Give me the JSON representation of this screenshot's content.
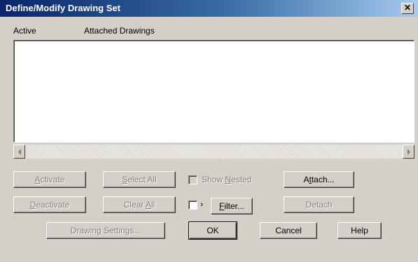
{
  "window": {
    "title": "Define/Modify Drawing Set",
    "close_glyph": "✕"
  },
  "list": {
    "columns": [
      {
        "label": "Active"
      },
      {
        "label": "Attached Drawings"
      }
    ],
    "rows": []
  },
  "buttons": {
    "activate": {
      "pre": "",
      "key": "A",
      "post": "ctivate"
    },
    "deactivate": {
      "pre": "",
      "key": "D",
      "post": "eactivate"
    },
    "select_all": {
      "pre": "",
      "key": "S",
      "post": "elect All"
    },
    "clear_all": {
      "pre": "Clear ",
      "key": "A",
      "post": "ll"
    },
    "attach": {
      "pre": "A",
      "key": "t",
      "post": "tach..."
    },
    "detach": {
      "pre": "Detach",
      "key": "",
      "post": ""
    },
    "filter": {
      "pre": "",
      "key": "F",
      "post": "ilter..."
    },
    "drawing_settings": {
      "pre": "Drawin",
      "key": "g",
      "post": " Settings..."
    },
    "ok": {
      "pre": "OK",
      "key": "",
      "post": ""
    },
    "cancel": {
      "pre": "Cancel",
      "key": "",
      "post": ""
    },
    "help": {
      "pre": "Help",
      "key": "",
      "post": ""
    }
  },
  "show_nested": {
    "pre": "Show ",
    "key": "N",
    "post": "ested",
    "checked": false,
    "enabled": false
  },
  "filter_checkbox": {
    "checked": false,
    "indicator": "›"
  },
  "colors": {
    "face": "#d4d0c8",
    "title_start": "#0a246a",
    "title_end": "#a6caf0",
    "disabled_text": "#808080"
  }
}
